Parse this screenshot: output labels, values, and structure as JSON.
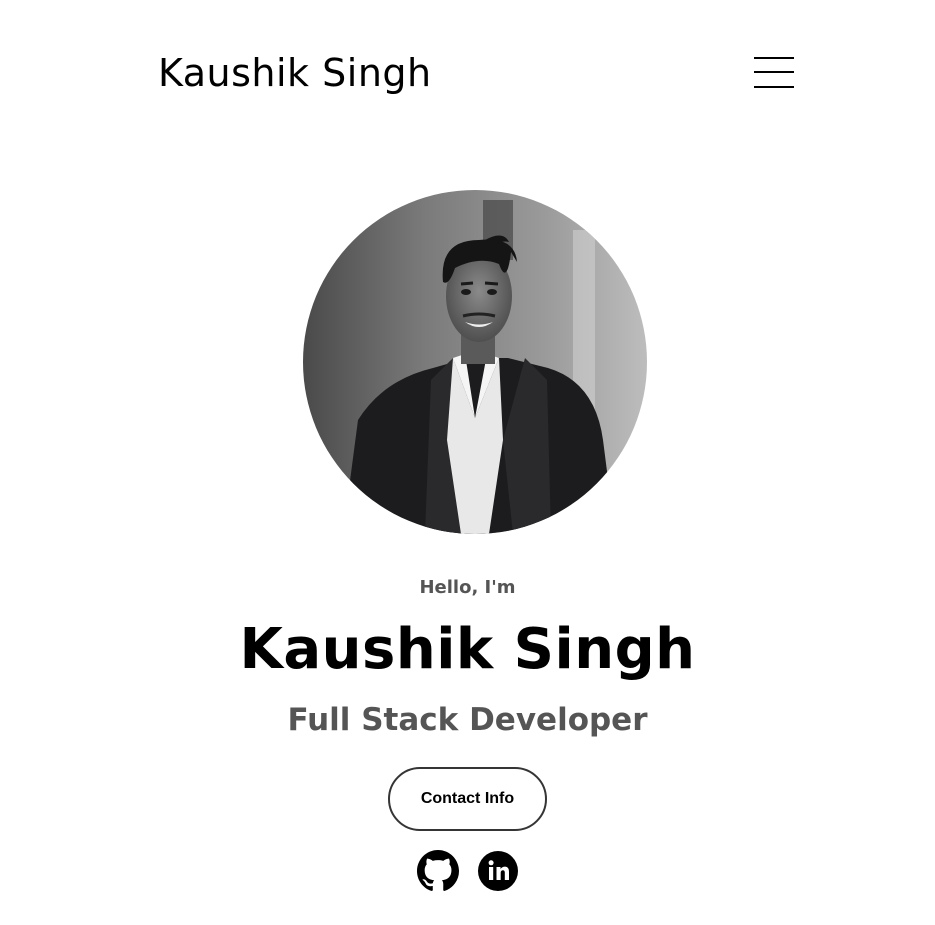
{
  "nav": {
    "logo": "Kaushik Singh",
    "menu_icon": "hamburger-menu-icon"
  },
  "hero": {
    "photo_alt": "Kaushik Singh profile photo",
    "greeting": "Hello, I'm",
    "name": "Kaushik Singh",
    "role": "Full Stack Developer",
    "contact_button": "Contact Info"
  },
  "socials": [
    {
      "icon": "github-icon",
      "label": "GitHub"
    },
    {
      "icon": "linkedin-icon",
      "label": "LinkedIn"
    }
  ],
  "colors": {
    "text_primary": "#000000",
    "text_secondary": "#555555",
    "button_border": "#353535",
    "background": "#ffffff"
  }
}
